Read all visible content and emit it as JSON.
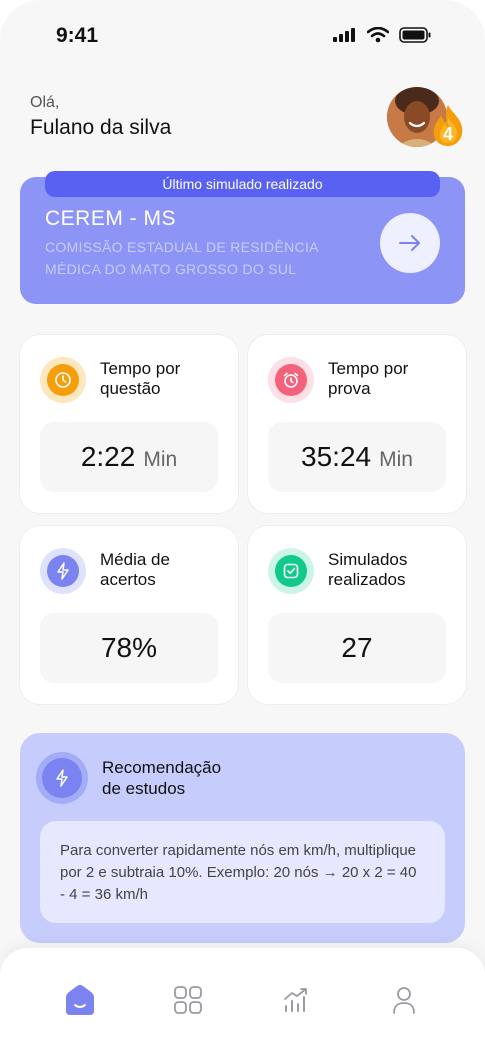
{
  "status_bar": {
    "time": "9:41"
  },
  "greeting": {
    "hello": "Olá,",
    "name": "Fulano da silva",
    "streak": "4"
  },
  "last_simulation": {
    "tag": "Último simulado realizado",
    "title": "CEREM - MS",
    "description": "COMISSÃO ESTADUAL DE RESIDÊNCIA MÉDICA DO MATO GROSSO DO SUL"
  },
  "stats": [
    {
      "label": "Tempo por questão",
      "value": "2:22",
      "unit": "Min",
      "icon": "clock-icon",
      "color": "#f59e0b"
    },
    {
      "label": "Tempo por prova",
      "value": "35:24",
      "unit": "Min",
      "icon": "alarm-icon",
      "color": "#f4617a"
    },
    {
      "label": "Média de acertos",
      "value": "78%",
      "unit": "",
      "icon": "bolt-icon",
      "color": "#7b83f1"
    },
    {
      "label": "Simulados realizados",
      "value": "27",
      "unit": "",
      "icon": "check-square-icon",
      "color": "#10c98a"
    }
  ],
  "recommendation": {
    "title": "Recomendação de estudos",
    "text": "Para converter rapidamente nós em km/h, multiplique por 2 e subtraia 10%. Exemplo: 20 nós → 20 x 2 = 40 - 4 = 36 km/h"
  },
  "nav": {
    "active": "home",
    "items": [
      "home-icon",
      "grid-icon",
      "chart-icon",
      "user-icon"
    ]
  },
  "colors": {
    "accent": "#5961f2",
    "card_bg": "#8c94f6",
    "rec_bg": "#c6cdfc"
  }
}
